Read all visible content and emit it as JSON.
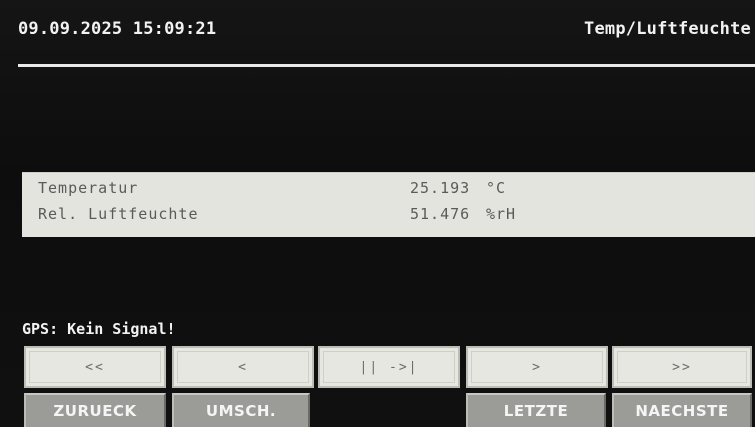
{
  "header": {
    "datetime": "09.09.2025 15:09:21",
    "title": "Temp/Luftfeuchte"
  },
  "readings": [
    {
      "label": "Temperatur",
      "value": "25.193",
      "unit": "°C"
    },
    {
      "label": "Rel. Luftfeuchte",
      "value": "51.476",
      "unit": "%rH"
    }
  ],
  "gps_status": "GPS: Kein Signal!",
  "nav_buttons": [
    {
      "label": "<<"
    },
    {
      "label": "<"
    },
    {
      "label": "|| ->|"
    },
    {
      "label": ">"
    },
    {
      "label": ">>"
    }
  ],
  "soft_keys": [
    {
      "label": "ZURUECK"
    },
    {
      "label": "UMSCH."
    },
    {
      "label": "LETZTE"
    },
    {
      "label": "NAECHSTE"
    }
  ],
  "colors": {
    "screen_bg": "#0d0d0d",
    "panel_bg": "#e4e4de",
    "soft_key_bg": "#9b9b98",
    "text_light": "#f2f2f2"
  }
}
